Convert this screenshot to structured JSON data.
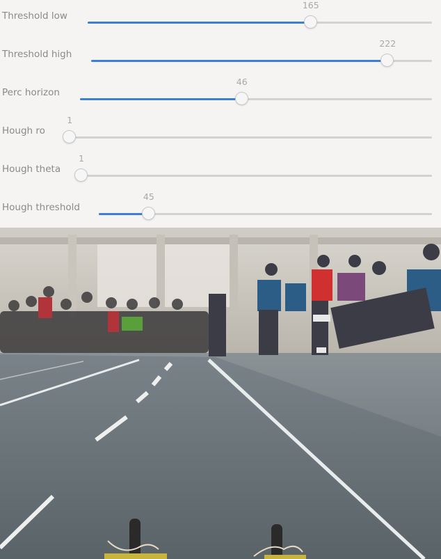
{
  "sliders": [
    {
      "label": "Threshold low",
      "value": "165",
      "fraction": 0.648
    },
    {
      "label": "Threshold high",
      "value": "222",
      "fraction": 0.87
    },
    {
      "label": "Perc horizon",
      "value": "46",
      "fraction": 0.46
    },
    {
      "label": "Hough ro",
      "value": "1",
      "fraction": 0.01
    },
    {
      "label": "Hough theta",
      "value": "1",
      "fraction": 0.0
    },
    {
      "label": "Hough threshold",
      "value": "45",
      "fraction": 0.15
    }
  ],
  "camera_feed": {
    "description_icon": "camera-feed-image"
  }
}
